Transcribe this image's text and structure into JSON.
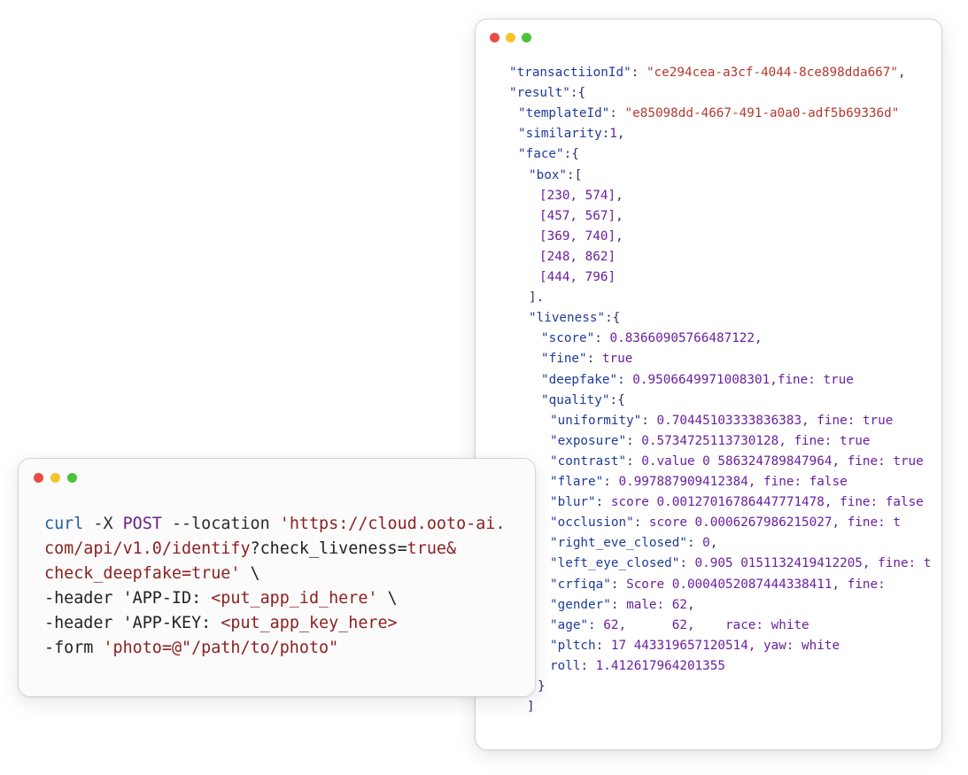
{
  "json_window": {
    "lines": [
      {
        "k": "\"transactiionId\"",
        "p": ": ",
        "s": "\"ce294cea-a3cf-4044-8ce898dda667\"",
        "v": "",
        "t": ","
      },
      {
        "k": "\"result\"",
        "p": ":{",
        "s": "",
        "v": "",
        "t": ""
      },
      {
        "k": "\"templateId\"",
        "p": ": ",
        "s": "\"e85098dd-4667-491-a0a0-adf5b69336d\"",
        "v": "",
        "t": ""
      },
      {
        "k": "\"similarity",
        "p": ":",
        "s": "",
        "v": "1",
        "t": ","
      },
      {
        "k": "\"face\"",
        "p": ":{",
        "s": "",
        "v": "",
        "t": ""
      },
      {
        "k": "\"box\"",
        "p": ":[",
        "s": "",
        "v": "",
        "t": ""
      },
      {
        "k": "",
        "p": "",
        "s": "",
        "v": "[230, 574]",
        "t": ","
      },
      {
        "k": "",
        "p": "",
        "s": "",
        "v": "[457, 567]",
        "t": ","
      },
      {
        "k": "",
        "p": "",
        "s": "",
        "v": "[369, 740]",
        "t": ","
      },
      {
        "k": "",
        "p": "",
        "s": "",
        "v": "[248, 862]",
        "t": ""
      },
      {
        "k": "",
        "p": "",
        "s": "",
        "v": "[444, 796]",
        "t": ""
      },
      {
        "k": "",
        "p": "].",
        "s": "",
        "v": "",
        "t": ""
      },
      {
        "k": "\"liveness\"",
        "p": ":{",
        "s": "",
        "v": "",
        "t": ""
      },
      {
        "k": "\"score\"",
        "p": ": ",
        "s": "",
        "v": "0.83660905766487122",
        "t": ","
      },
      {
        "k": "\"fine\"",
        "p": ": ",
        "s": "",
        "v": "true",
        "t": ""
      },
      {
        "k": "\"deepfake\"",
        "p": ": ",
        "s": "",
        "v": "0.9506649971008301,fine: true",
        "t": ""
      },
      {
        "k": "\"quality\"",
        "p": ":{",
        "s": "",
        "v": "",
        "t": ""
      },
      {
        "k": "\"uniformity\"",
        "p": ": ",
        "s": "",
        "v": "0.70445103333836383, fine: true",
        "t": ""
      },
      {
        "k": "\"exposure\"",
        "p": ": ",
        "s": "",
        "v": "0.5734725113730128, fine: true",
        "t": ""
      },
      {
        "k": "\"contrast\"",
        "p": ": ",
        "s": "",
        "v": "0.value 0 586324789847964, fine: true",
        "t": ""
      },
      {
        "k": "\"flare\"",
        "p": ": ",
        "s": "",
        "v": "0.997887909412384, fine: false",
        "t": ""
      },
      {
        "k": "\"blur\"",
        "p": ": ",
        "s": "",
        "v": "score 0.00127016786447771478, fine: false",
        "t": ""
      },
      {
        "k": "\"occlusion\"",
        "p": ": ",
        "s": "",
        "v": "score 0.0006267986215027, fine: t",
        "t": ""
      },
      {
        "k": "\"right_eve_closed\"",
        "p": ": ",
        "s": "",
        "v": "0",
        "t": ","
      },
      {
        "k": "\"left_eye_closed\"",
        "p": ": ",
        "s": "",
        "v": "0.905 0151132419412205, fine: t",
        "t": ""
      },
      {
        "k": "\"crfiqa\"",
        "p": ": ",
        "s": "",
        "v": "Score 0.0004052087444338411, fine:",
        "t": ""
      },
      {
        "k": "\"gender\"",
        "p": ": ",
        "s": "",
        "v": "male: 62",
        "t": ","
      },
      {
        "k": "\"age\"",
        "p": ": ",
        "s": "",
        "v": "62,      62,    race: white",
        "t": ""
      },
      {
        "k": "\"pltch",
        "p": ": ",
        "s": "",
        "v": "17 443319657120514, yaw: white",
        "t": ""
      },
      {
        "k": "roll",
        "p": ": ",
        "s": "",
        "v": "1.412617964201355",
        "t": ""
      },
      {
        "k": "",
        "p": "}",
        "s": "",
        "v": "",
        "t": ""
      },
      {
        "k": "",
        "p": "]",
        "s": "",
        "v": "",
        "t": ""
      }
    ]
  },
  "curl_window": {
    "lines": [
      [
        {
          "c": "c-cmd",
          "t": "curl"
        },
        {
          "c": "c-flag",
          "t": " -X "
        },
        {
          "c": "c-kw",
          "t": "POST"
        },
        {
          "c": "c-flag",
          "t": " --location "
        },
        {
          "c": "c-str",
          "t": "'https://cloud.ooto-ai."
        }
      ],
      [
        {
          "c": "c-str",
          "t": "com/api/v1.0/identify"
        },
        {
          "c": "c-def",
          "t": "?check_liveness="
        },
        {
          "c": "c-str",
          "t": "true&"
        }
      ],
      [
        {
          "c": "c-str",
          "t": "check_deepfake=true'"
        },
        {
          "c": "c-def",
          "t": " \\"
        }
      ],
      [
        {
          "c": "c-def",
          "t": "-header 'APP-ID: "
        },
        {
          "c": "c-str",
          "t": "<put_app_id_here'"
        },
        {
          "c": "c-def",
          "t": " \\"
        }
      ],
      [
        {
          "c": "c-def",
          "t": "-header 'APP-KEY: "
        },
        {
          "c": "c-str",
          "t": "<put_app_key_here>"
        }
      ],
      [
        {
          "c": "c-def",
          "t": "-form "
        },
        {
          "c": "c-str",
          "t": "'photo=@\"/path/to/photo\""
        }
      ]
    ]
  },
  "colors": {
    "dot_red": "#ec4b45",
    "dot_yellow": "#f5c42c",
    "dot_green": "#4cc23b"
  }
}
